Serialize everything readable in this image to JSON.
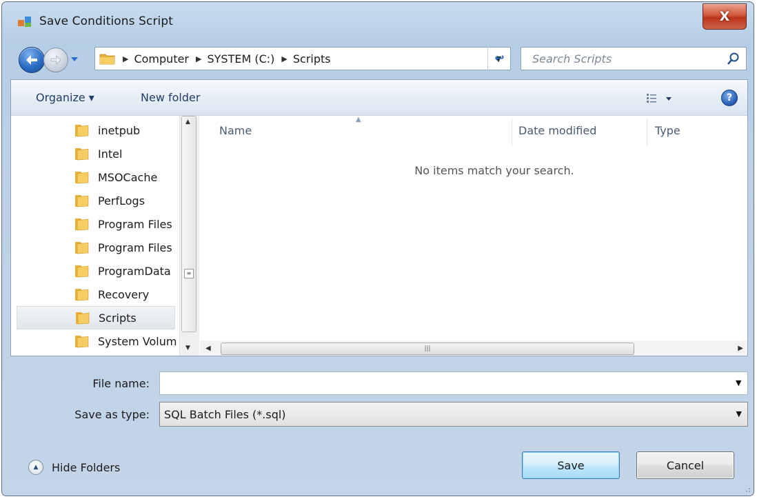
{
  "window": {
    "title": "Save Conditions Script",
    "close_glyph": "X"
  },
  "nav": {
    "breadcrumb": [
      "Computer",
      "SYSTEM (C:)",
      "Scripts"
    ],
    "refresh_glyph": "↩",
    "search_placeholder": "Search Scripts"
  },
  "toolbar": {
    "organize_label": "Organize ▾",
    "new_folder_label": "New folder",
    "help_glyph": "?"
  },
  "tree": {
    "items": [
      {
        "label": "inetpub"
      },
      {
        "label": "Intel"
      },
      {
        "label": "MSOCache"
      },
      {
        "label": "PerfLogs"
      },
      {
        "label": "Program Files"
      },
      {
        "label": "Program Files"
      },
      {
        "label": "ProgramData"
      },
      {
        "label": "Recovery"
      },
      {
        "label": "Scripts",
        "selected": true
      },
      {
        "label": "System Volume"
      }
    ]
  },
  "file_list": {
    "columns": {
      "name": "Name",
      "date_modified": "Date modified",
      "type": "Type"
    },
    "empty_message": "No items match your search."
  },
  "form": {
    "file_name_label": "File name:",
    "file_name_value": "",
    "save_as_type_label": "Save as type:",
    "save_as_type_value": "SQL Batch Files (*.sql)"
  },
  "footer": {
    "hide_folders_label": "Hide Folders",
    "save_label": "Save",
    "cancel_label": "Cancel"
  },
  "colors": {
    "accent": "#2a6cc4",
    "close": "#c8452a",
    "folder": "#e8b23a"
  }
}
